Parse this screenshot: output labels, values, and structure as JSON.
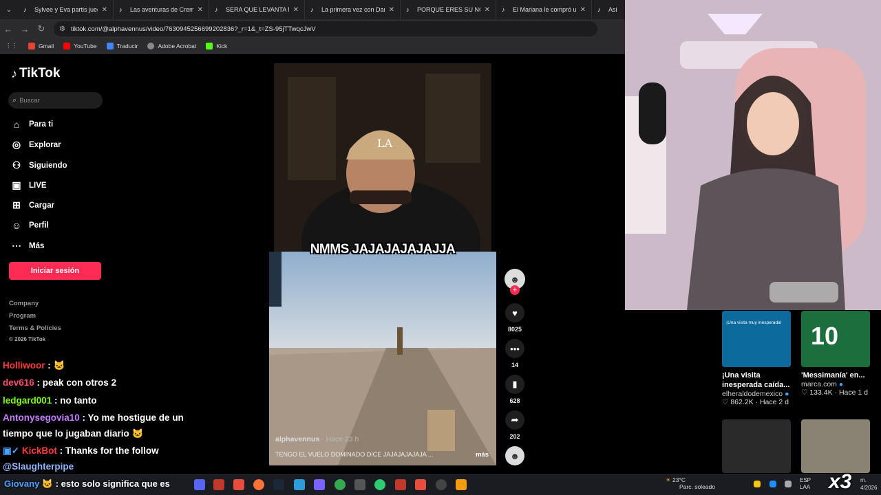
{
  "browser": {
    "tabs": [
      {
        "title": "Sylvee y Eva partis juegan"
      },
      {
        "title": "Las aventuras de Cremi e"
      },
      {
        "title": "SERA QUE LEVANTA MAS"
      },
      {
        "title": "La primera vez con Dani F"
      },
      {
        "title": "PORQUE ERES SU NOVIO"
      },
      {
        "title": "El Mariana le compró un"
      },
      {
        "title": "Asi o ma"
      }
    ],
    "url": "tiktok.com/@alphavennus/video/7630945256699202836?_r=1&_t=ZS-95jTTwqcJwV",
    "bookmarks": [
      {
        "label": "Gmail",
        "color": "#ea4335"
      },
      {
        "label": "YouTube",
        "color": "#ff0000"
      },
      {
        "label": "Traducir",
        "color": "#4285f4"
      },
      {
        "label": "Adobe Acrobat",
        "color": "#888888"
      },
      {
        "label": "Kick",
        "color": "#53fc18"
      }
    ]
  },
  "tiktok": {
    "brand": "TikTok",
    "search_placeholder": "Buscar",
    "nav": [
      {
        "label": "Para ti",
        "icon": "home-icon"
      },
      {
        "label": "Explorar",
        "icon": "compass-icon"
      },
      {
        "label": "Siguiendo",
        "icon": "following-icon"
      },
      {
        "label": "LIVE",
        "icon": "live-icon"
      },
      {
        "label": "Cargar",
        "icon": "upload-icon"
      },
      {
        "label": "Perfil",
        "icon": "profile-icon"
      },
      {
        "label": "Más",
        "icon": "more-icon"
      }
    ],
    "login_button": "Iniciar sesión",
    "footer": [
      "Company",
      "Program",
      "Terms & Policies"
    ],
    "copyright": "© 2026 TikTok",
    "video": {
      "caption_overlay": "NMMS JAJAJAJAJAJJA",
      "author": "alphavennus",
      "time": "· Hace 23 h",
      "description": "TENGO EL VUELO DOMINADO DICE JAJAJAJAJAJA ...",
      "more": "más",
      "likes": "8025",
      "comments": "14",
      "saves": "628",
      "shares": "202"
    }
  },
  "chat": [
    {
      "user": "Holliwoor",
      "msg": " : 🐱",
      "color": "#ff3b3b"
    },
    {
      "user": "dev616",
      "msg": " : peak con otros 2",
      "color": "#ff4d6d"
    },
    {
      "user": "ledgard001",
      "msg": " : no tanto",
      "color": "#7cfc00"
    },
    {
      "user": "Antonysegovia10",
      "msg": " : Yo me hostigue de un",
      "color": "#c77dff"
    },
    {
      "user": "",
      "msg": "tiempo que lo jugaban diario 🐱",
      "color": "#ffffff"
    },
    {
      "user": "KickBot",
      "msg": " : Thanks for the follow",
      "color": "#ff3b3b"
    },
    {
      "user": "@Slaughterpipe",
      "msg": "",
      "color": "#8fb7ff"
    }
  ],
  "bottom_chat": {
    "user": "Giovany",
    "msg": "esto solo significa que es"
  },
  "recommendations": [
    {
      "title": "¡Una visita inesperada caída...",
      "channel": "elheraldodemexico",
      "views": "862.2K",
      "age": "Hace 2 d",
      "thumb_text": "¡Una visita muy inesperada!"
    },
    {
      "title": "'Messimanía' en...",
      "channel": "marca.com",
      "views": "133.4K",
      "age": "Hace 1 d",
      "thumb_text": "10"
    }
  ],
  "taskbar": {
    "weather_temp": "23°C",
    "weather_desc": "Parc. soleado",
    "lang_top": "ESP",
    "lang_bottom": "LAA",
    "date_top": "m.",
    "date_bottom": "4/2026",
    "overlay_badge": "x3"
  }
}
